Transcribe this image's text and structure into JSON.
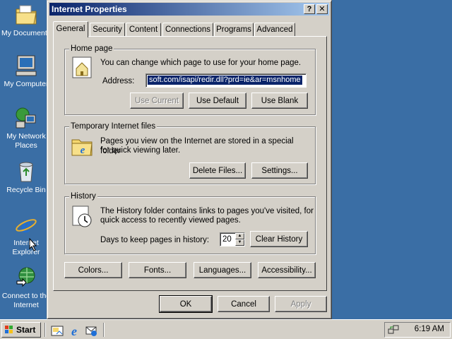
{
  "desktop": {
    "icons": [
      {
        "label": "My Documents",
        "icon": "folder-documents-icon"
      },
      {
        "label": "My Computer",
        "icon": "computer-icon"
      },
      {
        "label": "My Network Places",
        "icon": "network-places-icon"
      },
      {
        "label": "Recycle Bin",
        "icon": "recycle-bin-icon"
      },
      {
        "label": "Internet Explorer",
        "icon": "internet-explorer-icon"
      },
      {
        "label": "Connect to the Internet",
        "icon": "connect-internet-icon"
      }
    ]
  },
  "dialog": {
    "title": "Internet Properties",
    "help_label": "?",
    "close_label": "✕",
    "tabs": [
      "General",
      "Security",
      "Content",
      "Connections",
      "Programs",
      "Advanced"
    ],
    "active_tab": "General",
    "home_page": {
      "group_title": "Home page",
      "description": "You can change which page to use for your home page.",
      "address_label": "Address:",
      "address_value": "soft.com/isapi/redir.dll?prd=ie&ar=msnhome",
      "use_current": "Use Current",
      "use_default": "Use Default",
      "use_blank": "Use Blank"
    },
    "temp_files": {
      "group_title": "Temporary Internet files",
      "description_line1": "Pages you view on the Internet are stored in a special folder",
      "description_line2": "for quick viewing later.",
      "delete_files": "Delete Files...",
      "settings": "Settings..."
    },
    "history": {
      "group_title": "History",
      "description_line1": "The History folder contains links to pages you've visited, for",
      "description_line2": "quick access to recently viewed pages.",
      "days_label": "Days to keep pages in history:",
      "days_value": "20",
      "clear_history": "Clear History"
    },
    "bottom_buttons": {
      "colors": "Colors...",
      "fonts": "Fonts...",
      "languages": "Languages...",
      "accessibility": "Accessibility..."
    },
    "ok": "OK",
    "cancel": "Cancel",
    "apply": "Apply"
  },
  "taskbar": {
    "start_label": "Start",
    "clock": "6:19 AM",
    "quick_launch": [
      "show-desktop-icon",
      "internet-explorer-icon",
      "outlook-express-icon"
    ]
  },
  "colors": {
    "desktop": "#3a6ea5",
    "titlebar_start": "#0a246a",
    "titlebar_end": "#a6caf0",
    "selection": "#0a246a"
  }
}
